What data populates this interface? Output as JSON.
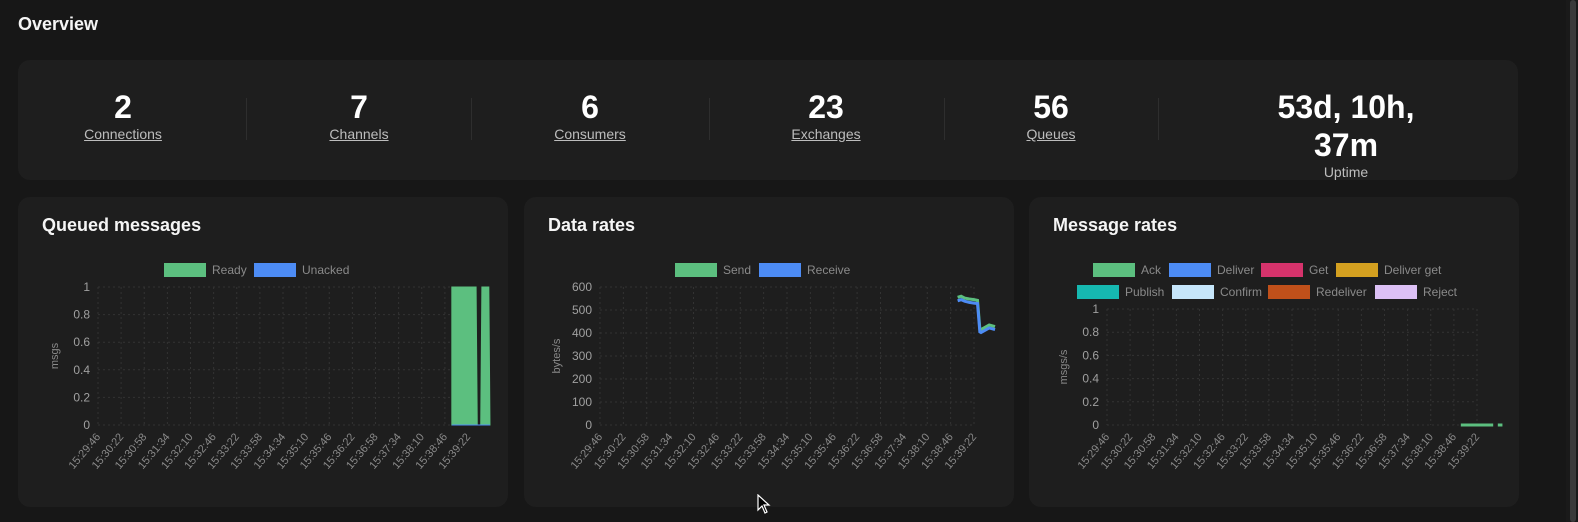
{
  "page_title": "Overview",
  "stats": [
    {
      "value": "2",
      "label": "Connections",
      "link": true
    },
    {
      "value": "7",
      "label": "Channels",
      "link": true
    },
    {
      "value": "6",
      "label": "Consumers",
      "link": true
    },
    {
      "value": "23",
      "label": "Exchanges",
      "link": true
    },
    {
      "value": "56",
      "label": "Queues",
      "link": true
    },
    {
      "value": "53d, 10h, 37m",
      "label": "Uptime",
      "link": false
    }
  ],
  "chart_data": [
    {
      "type": "area",
      "title": "Queued messages",
      "ylabel": "msgs",
      "ylim": [
        0,
        1
      ],
      "yticks": [
        "0",
        "0.2",
        "0.4",
        "0.6",
        "0.8",
        "1"
      ],
      "x": [
        "15:29:46",
        "15:30:22",
        "15:30:58",
        "15:31:34",
        "15:32:10",
        "15:32:46",
        "15:33:22",
        "15:33:58",
        "15:34:34",
        "15:35:10",
        "15:35:46",
        "15:36:22",
        "15:36:58",
        "15:37:34",
        "15:38:10",
        "15:38:46",
        "15:39:22"
      ],
      "series": [
        {
          "name": "Ready",
          "color": "#5cbf7f",
          "points": [
            [
              15.3,
              1
            ],
            [
              16.35,
              1
            ],
            [
              16.4,
              0
            ],
            [
              16.55,
              0
            ],
            [
              16.6,
              1
            ],
            [
              16.9,
              1
            ],
            [
              16.95,
              0
            ]
          ]
        },
        {
          "name": "Unacked",
          "color": "#4d8cf5",
          "points": [
            [
              15.3,
              0
            ],
            [
              16.95,
              0
            ]
          ]
        }
      ]
    },
    {
      "type": "line",
      "title": "Data rates",
      "ylabel": "bytes/s",
      "ylim": [
        0,
        600
      ],
      "yticks": [
        "0",
        "100",
        "200",
        "300",
        "400",
        "500",
        "600"
      ],
      "x": [
        "15:29:46",
        "15:30:22",
        "15:30:58",
        "15:31:34",
        "15:32:10",
        "15:32:46",
        "15:33:22",
        "15:33:58",
        "15:34:34",
        "15:35:10",
        "15:35:46",
        "15:36:22",
        "15:36:58",
        "15:37:34",
        "15:38:10",
        "15:38:46",
        "15:39:22"
      ],
      "series": [
        {
          "name": "Send",
          "color": "#5cbf7f",
          "points": [
            [
              15.3,
              555
            ],
            [
              15.45,
              560
            ],
            [
              15.6,
              552
            ],
            [
              15.8,
              548
            ],
            [
              16.0,
              545
            ],
            [
              16.15,
              542
            ],
            [
              16.25,
              418
            ],
            [
              16.3,
              415
            ],
            [
              16.65,
              435
            ],
            [
              16.9,
              428
            ]
          ]
        },
        {
          "name": "Receive",
          "color": "#4d8cf5",
          "points": [
            [
              15.3,
              540
            ],
            [
              15.45,
              545
            ],
            [
              15.6,
              538
            ],
            [
              15.8,
              533
            ],
            [
              16.0,
              530
            ],
            [
              16.15,
              528
            ],
            [
              16.25,
              405
            ],
            [
              16.3,
              402
            ],
            [
              16.65,
              422
            ],
            [
              16.9,
              415
            ]
          ]
        }
      ]
    },
    {
      "type": "line",
      "title": "Message rates",
      "ylabel": "msgs/s",
      "ylim": [
        0,
        1
      ],
      "yticks": [
        "0",
        "0.2",
        "0.4",
        "0.6",
        "0.8",
        "1"
      ],
      "x": [
        "15:29:46",
        "15:30:22",
        "15:30:58",
        "15:31:34",
        "15:32:10",
        "15:32:46",
        "15:33:22",
        "15:33:58",
        "15:34:34",
        "15:35:10",
        "15:35:46",
        "15:36:22",
        "15:36:58",
        "15:37:34",
        "15:38:10",
        "15:38:46",
        "15:39:22"
      ],
      "series": [
        {
          "name": "Ack",
          "color": "#5cbf7f",
          "points": [
            [
              15.3,
              0
            ],
            [
              16.7,
              0
            ],
            [
              16.75,
              null
            ],
            [
              16.9,
              0
            ],
            [
              17.1,
              0
            ]
          ]
        },
        {
          "name": "Deliver",
          "color": "#4d8cf5",
          "points": []
        },
        {
          "name": "Get",
          "color": "#d6336c",
          "points": []
        },
        {
          "name": "Deliver get",
          "color": "#d4a020",
          "points": []
        },
        {
          "name": "Publish",
          "color": "#16b8b0",
          "points": []
        },
        {
          "name": "Confirm",
          "color": "#c6e6fa",
          "points": []
        },
        {
          "name": "Redeliver",
          "color": "#c0501a",
          "points": []
        },
        {
          "name": "Reject",
          "color": "#dcc0f5",
          "points": []
        }
      ]
    }
  ]
}
